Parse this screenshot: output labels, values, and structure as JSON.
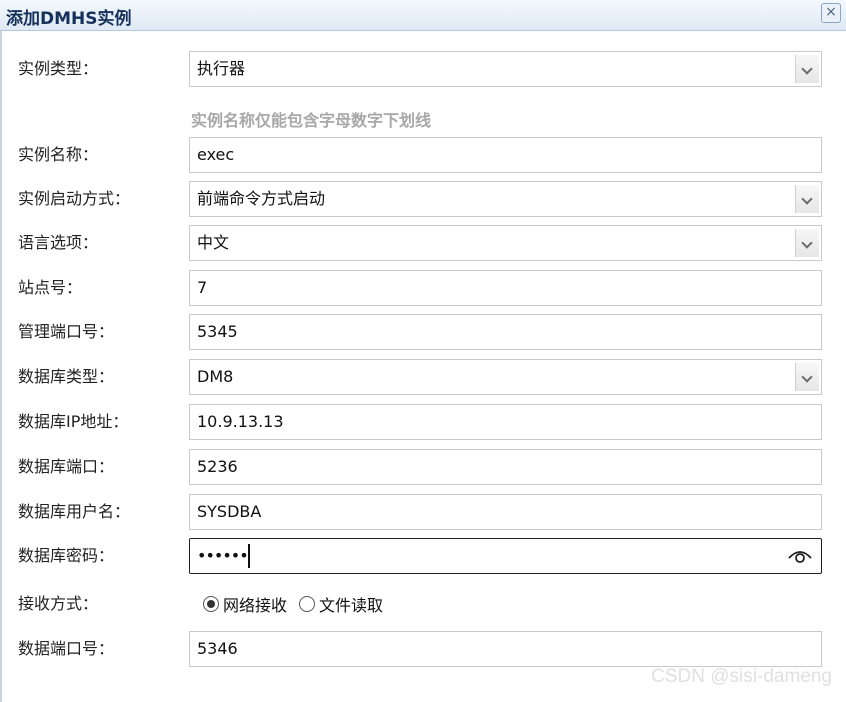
{
  "dialog": {
    "title": "添加DMHS实例",
    "close_label": "×"
  },
  "form": {
    "instance_type": {
      "label": "实例类型：",
      "value": "执行器"
    },
    "name_hint": "实例名称仅能包含字母数字下划线",
    "instance_name": {
      "label": "实例名称：",
      "value": "exec"
    },
    "start_mode": {
      "label": "实例启动方式：",
      "value": "前端命令方式启动"
    },
    "language": {
      "label": "语言选项：",
      "value": "中文"
    },
    "site_no": {
      "label": "站点号：",
      "value": "7"
    },
    "mgmt_port": {
      "label": "管理端口号：",
      "value": "5345"
    },
    "db_type": {
      "label": "数据库类型：",
      "value": "DM8"
    },
    "db_ip": {
      "label": "数据库IP地址：",
      "value": "10.9.13.13"
    },
    "db_port": {
      "label": "数据库端口：",
      "value": "5236"
    },
    "db_user": {
      "label": "数据库用户名：",
      "value": "SYSDBA"
    },
    "db_password": {
      "label": "数据库密码：",
      "value": "••••••"
    },
    "receive_mode": {
      "label": "接收方式：",
      "options": [
        "网络接收",
        "文件读取"
      ],
      "selected": "网络接收"
    },
    "data_port": {
      "label": "数据端口号：",
      "value": "5346"
    }
  },
  "icons": {
    "select_arrow": "chevron-down-icon",
    "password_toggle": "eye-icon",
    "close": "close-icon"
  },
  "watermark": "CSDN @sisi-dameng",
  "colors": {
    "title_text": "#15305a",
    "hint_text": "#a8a8a8",
    "titlebar_bg": "#dfe9f4"
  }
}
